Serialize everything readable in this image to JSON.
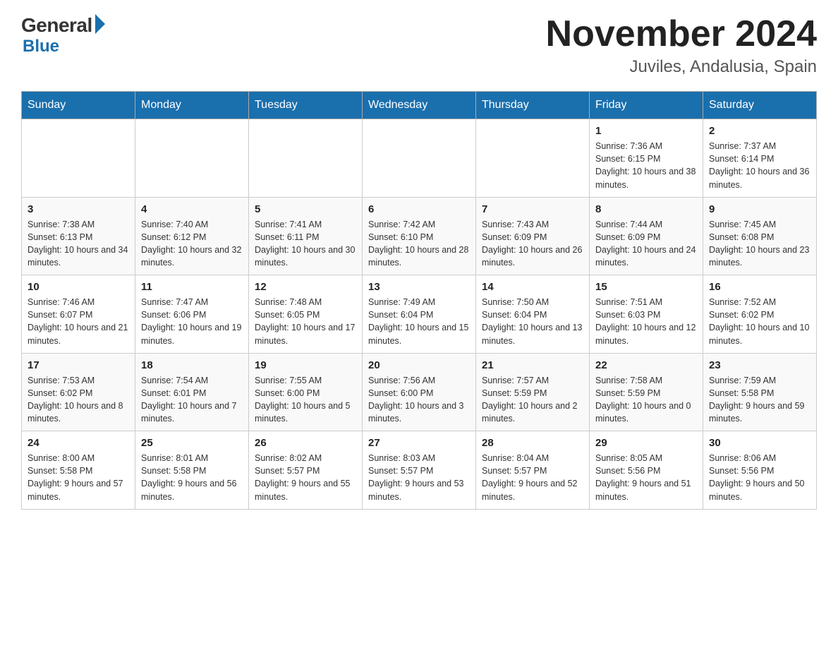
{
  "header": {
    "logo": {
      "general": "General",
      "blue": "Blue"
    },
    "title": "November 2024",
    "location": "Juviles, Andalusia, Spain"
  },
  "calendar": {
    "weekdays": [
      "Sunday",
      "Monday",
      "Tuesday",
      "Wednesday",
      "Thursday",
      "Friday",
      "Saturday"
    ],
    "weeks": [
      [
        {
          "day": "",
          "info": ""
        },
        {
          "day": "",
          "info": ""
        },
        {
          "day": "",
          "info": ""
        },
        {
          "day": "",
          "info": ""
        },
        {
          "day": "",
          "info": ""
        },
        {
          "day": "1",
          "info": "Sunrise: 7:36 AM\nSunset: 6:15 PM\nDaylight: 10 hours and 38 minutes."
        },
        {
          "day": "2",
          "info": "Sunrise: 7:37 AM\nSunset: 6:14 PM\nDaylight: 10 hours and 36 minutes."
        }
      ],
      [
        {
          "day": "3",
          "info": "Sunrise: 7:38 AM\nSunset: 6:13 PM\nDaylight: 10 hours and 34 minutes."
        },
        {
          "day": "4",
          "info": "Sunrise: 7:40 AM\nSunset: 6:12 PM\nDaylight: 10 hours and 32 minutes."
        },
        {
          "day": "5",
          "info": "Sunrise: 7:41 AM\nSunset: 6:11 PM\nDaylight: 10 hours and 30 minutes."
        },
        {
          "day": "6",
          "info": "Sunrise: 7:42 AM\nSunset: 6:10 PM\nDaylight: 10 hours and 28 minutes."
        },
        {
          "day": "7",
          "info": "Sunrise: 7:43 AM\nSunset: 6:09 PM\nDaylight: 10 hours and 26 minutes."
        },
        {
          "day": "8",
          "info": "Sunrise: 7:44 AM\nSunset: 6:09 PM\nDaylight: 10 hours and 24 minutes."
        },
        {
          "day": "9",
          "info": "Sunrise: 7:45 AM\nSunset: 6:08 PM\nDaylight: 10 hours and 23 minutes."
        }
      ],
      [
        {
          "day": "10",
          "info": "Sunrise: 7:46 AM\nSunset: 6:07 PM\nDaylight: 10 hours and 21 minutes."
        },
        {
          "day": "11",
          "info": "Sunrise: 7:47 AM\nSunset: 6:06 PM\nDaylight: 10 hours and 19 minutes."
        },
        {
          "day": "12",
          "info": "Sunrise: 7:48 AM\nSunset: 6:05 PM\nDaylight: 10 hours and 17 minutes."
        },
        {
          "day": "13",
          "info": "Sunrise: 7:49 AM\nSunset: 6:04 PM\nDaylight: 10 hours and 15 minutes."
        },
        {
          "day": "14",
          "info": "Sunrise: 7:50 AM\nSunset: 6:04 PM\nDaylight: 10 hours and 13 minutes."
        },
        {
          "day": "15",
          "info": "Sunrise: 7:51 AM\nSunset: 6:03 PM\nDaylight: 10 hours and 12 minutes."
        },
        {
          "day": "16",
          "info": "Sunrise: 7:52 AM\nSunset: 6:02 PM\nDaylight: 10 hours and 10 minutes."
        }
      ],
      [
        {
          "day": "17",
          "info": "Sunrise: 7:53 AM\nSunset: 6:02 PM\nDaylight: 10 hours and 8 minutes."
        },
        {
          "day": "18",
          "info": "Sunrise: 7:54 AM\nSunset: 6:01 PM\nDaylight: 10 hours and 7 minutes."
        },
        {
          "day": "19",
          "info": "Sunrise: 7:55 AM\nSunset: 6:00 PM\nDaylight: 10 hours and 5 minutes."
        },
        {
          "day": "20",
          "info": "Sunrise: 7:56 AM\nSunset: 6:00 PM\nDaylight: 10 hours and 3 minutes."
        },
        {
          "day": "21",
          "info": "Sunrise: 7:57 AM\nSunset: 5:59 PM\nDaylight: 10 hours and 2 minutes."
        },
        {
          "day": "22",
          "info": "Sunrise: 7:58 AM\nSunset: 5:59 PM\nDaylight: 10 hours and 0 minutes."
        },
        {
          "day": "23",
          "info": "Sunrise: 7:59 AM\nSunset: 5:58 PM\nDaylight: 9 hours and 59 minutes."
        }
      ],
      [
        {
          "day": "24",
          "info": "Sunrise: 8:00 AM\nSunset: 5:58 PM\nDaylight: 9 hours and 57 minutes."
        },
        {
          "day": "25",
          "info": "Sunrise: 8:01 AM\nSunset: 5:58 PM\nDaylight: 9 hours and 56 minutes."
        },
        {
          "day": "26",
          "info": "Sunrise: 8:02 AM\nSunset: 5:57 PM\nDaylight: 9 hours and 55 minutes."
        },
        {
          "day": "27",
          "info": "Sunrise: 8:03 AM\nSunset: 5:57 PM\nDaylight: 9 hours and 53 minutes."
        },
        {
          "day": "28",
          "info": "Sunrise: 8:04 AM\nSunset: 5:57 PM\nDaylight: 9 hours and 52 minutes."
        },
        {
          "day": "29",
          "info": "Sunrise: 8:05 AM\nSunset: 5:56 PM\nDaylight: 9 hours and 51 minutes."
        },
        {
          "day": "30",
          "info": "Sunrise: 8:06 AM\nSunset: 5:56 PM\nDaylight: 9 hours and 50 minutes."
        }
      ]
    ]
  }
}
